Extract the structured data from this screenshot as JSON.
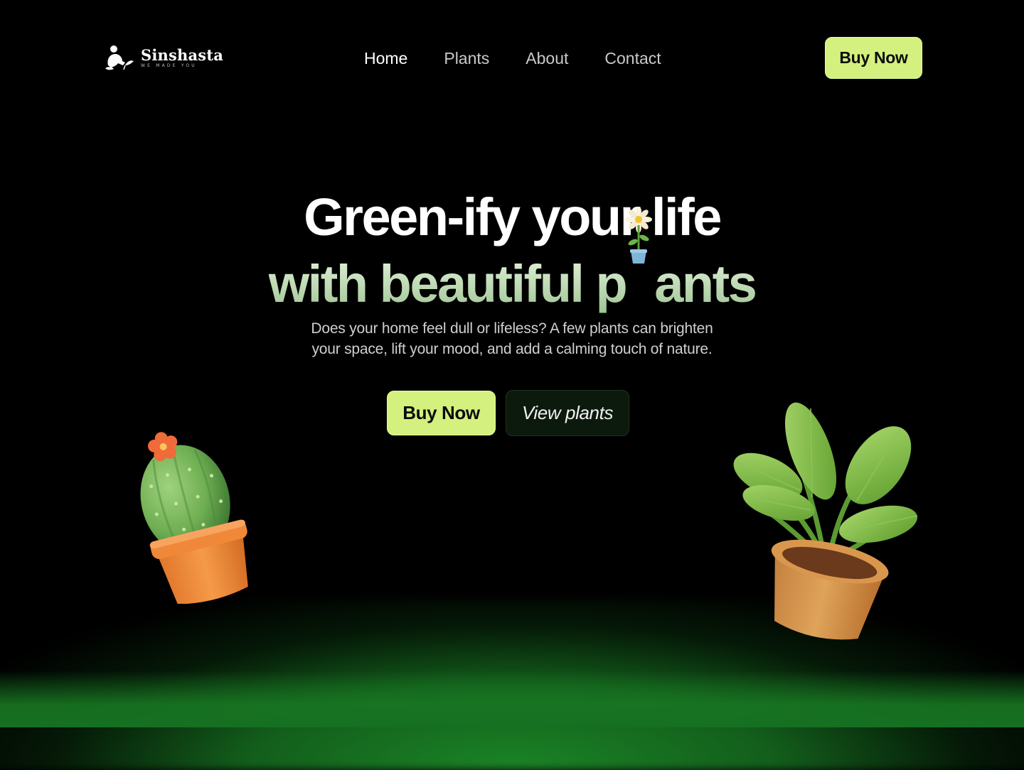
{
  "brand": {
    "name": "Sinshasta",
    "tagline": "WE MADE YOU"
  },
  "nav": {
    "items": [
      {
        "label": "Home",
        "active": true
      },
      {
        "label": "Plants",
        "active": false
      },
      {
        "label": "About",
        "active": false
      },
      {
        "label": "Contact",
        "active": false
      }
    ]
  },
  "header": {
    "cta_label": "Buy Now"
  },
  "hero": {
    "line1": "Green-ify your life",
    "line2_a": "with beautiful p",
    "line2_b": "ants",
    "subtitle_1": "Does your home feel dull or lifeless? A few plants can brighten",
    "subtitle_2": "your space, lift your mood, and add a calming touch of nature.",
    "buy_label": "Buy Now",
    "view_label": "View plants"
  },
  "colors": {
    "accent": "#d4f07e",
    "background": "#000000",
    "glow": "#167022"
  },
  "icons": {
    "logo": "gardener-logo-icon",
    "flower": "potted-flower-icon",
    "cactus": "cactus-pot-icon",
    "plant": "potted-plant-icon"
  }
}
